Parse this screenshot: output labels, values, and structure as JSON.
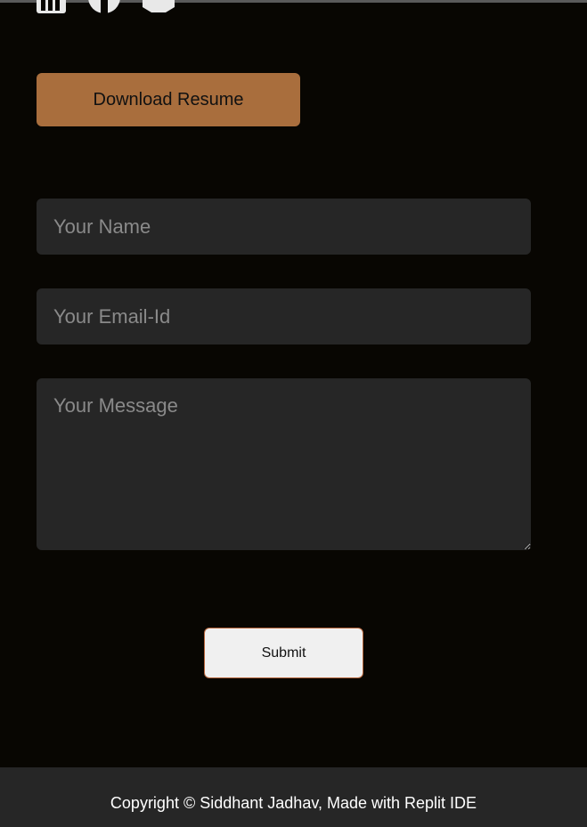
{
  "header": {
    "icons": [
      "linkedin-icon",
      "phone-icon",
      "tag-icon"
    ]
  },
  "resume": {
    "download_label": "Download Resume"
  },
  "contact_form": {
    "name_placeholder": "Your Name",
    "email_placeholder": "Your Email-Id",
    "message_placeholder": "Your Message",
    "submit_label": "Submit"
  },
  "footer": {
    "copyright": "Copyright © Siddhant Jadhav, Made with Replit IDE"
  },
  "colors": {
    "background": "#080602",
    "accent": "#a96e3d",
    "field_background": "#262626",
    "footer_background": "#262626"
  }
}
